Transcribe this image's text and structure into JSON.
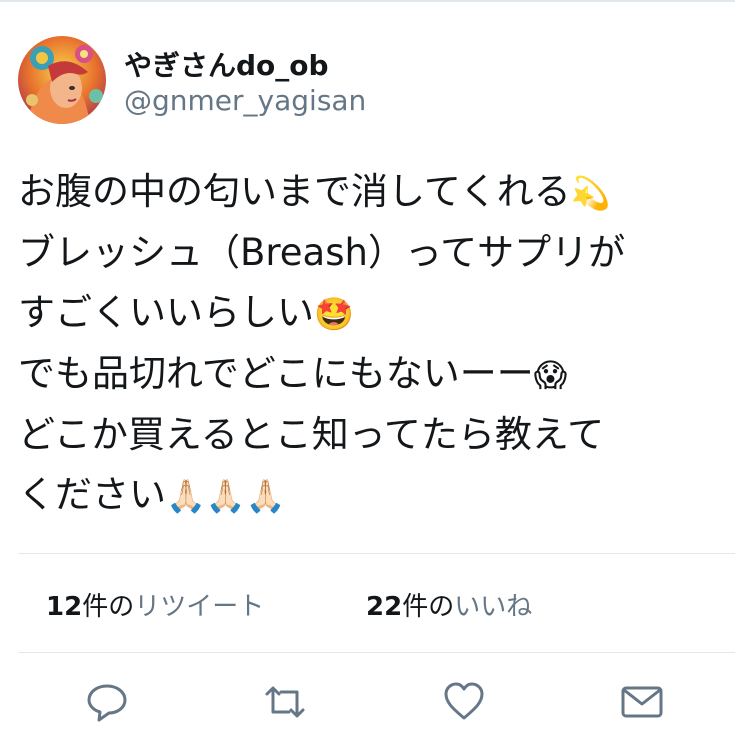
{
  "user": {
    "display_name": "やぎさんdo_ob",
    "handle": "@gnmer_yagisan",
    "avatar_icon": "avatar-illustration"
  },
  "tweet": {
    "lines": [
      "お腹の中の匂いまで消してくれる",
      "ブレッシュ（Breash）ってサプリが",
      "すごくいいらしい",
      "でも品切れでどこにもないーー",
      "どこか買えるとこ知ってたら教えて",
      "ください"
    ],
    "emojis": {
      "line1": "💫",
      "line3": "🤩",
      "line4": "😱",
      "line6": "🙏🏻🙏🏻🙏🏻"
    }
  },
  "stats": {
    "retweets": {
      "count": "12",
      "unit": "件の",
      "label": "リツイート"
    },
    "likes": {
      "count": "22",
      "unit": "件の",
      "label": "いいね"
    }
  },
  "actions": {
    "reply_icon": "reply-icon",
    "retweet_icon": "retweet-icon",
    "like_icon": "heart-icon",
    "dm_icon": "envelope-icon"
  },
  "colors": {
    "text": "#14171a",
    "secondary": "#657786",
    "divider": "#e1e8ed"
  }
}
